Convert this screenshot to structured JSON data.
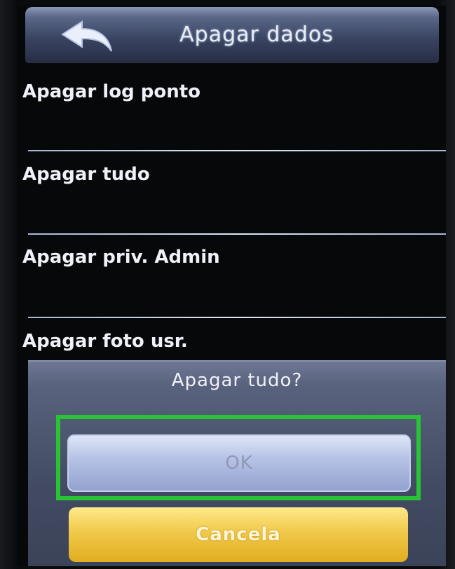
{
  "header": {
    "title": "Apagar dados",
    "back_icon": "back-arrow-icon"
  },
  "menu": {
    "items": [
      {
        "label": "Apagar log ponto"
      },
      {
        "label": "Apagar tudo"
      },
      {
        "label": "Apagar priv. Admin"
      },
      {
        "label": "Apagar foto usr."
      }
    ]
  },
  "dialog": {
    "title": "Apagar tudo?",
    "ok_label": "OK",
    "cancel_label": "Cancela"
  },
  "colors": {
    "header": "#3a4563",
    "ok_button": "#b7c3e6",
    "cancel_button": "#f0c94a",
    "highlight": "#28c433"
  }
}
